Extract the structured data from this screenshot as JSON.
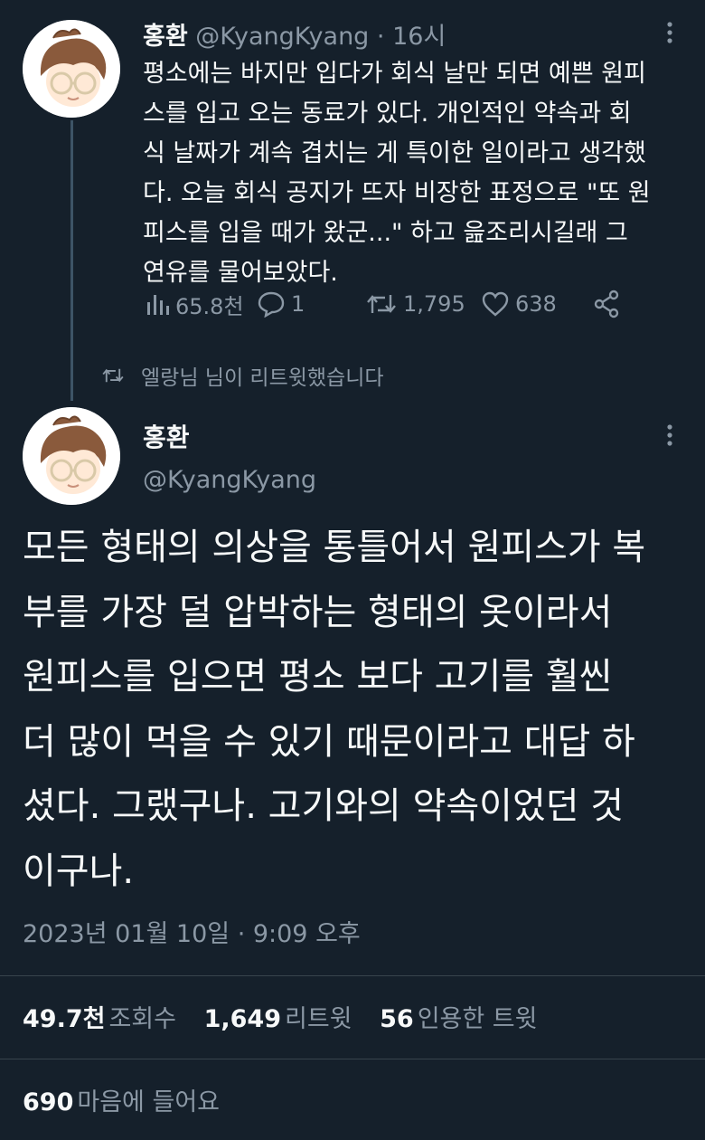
{
  "tweet1": {
    "display_name": "홍환",
    "handle": "@KyangKyang",
    "separator": "·",
    "time_ago": "16시",
    "text": "평소에는 바지만 입다가 회식 날만 되면 예쁜 원피\n스를 입고 오는 동료가 있다.  개인적인 약속과 회\n식 날짜가 계속 겹치는 게 특이한 일이라고 생각했\n다. 오늘 회식 공지가 뜨자 비장한 표정으로 \"또 원\n피스를 입을 때가 왔군...\" 하고 읊조리시길래 그\n연유를 물어보았다.",
    "actions": {
      "views": "65.8천",
      "replies": "1",
      "retweets": "1,795",
      "likes": "638"
    },
    "icons": [
      "analytics-icon",
      "reply-icon",
      "retweet-icon",
      "like-icon",
      "share-icon",
      "more-icon"
    ]
  },
  "retweet_note": "엘랑님 님이 리트윗했습니다",
  "tweet2": {
    "display_name": "홍환",
    "handle": "@KyangKyang",
    "text": "모든 형태의 의상을 통틀어서 원피스가 복\n부를 가장 덜 압박하는 형태의 옷이라서\n원피스를 입으면 평소 보다 고기를 훨씬\n더 많이 먹을 수 있기 때문이라고 대답 하\n셨다. 그랬구나. 고기와의 약속이었던 것\n이구나.",
    "timestamp": "2023년 01월 10일 · 9:09 오후",
    "stats": {
      "views_count": "49.7천",
      "views_label": "조회수",
      "retweets_count": "1,649",
      "retweets_label": "리트윗",
      "quotes_count": "56",
      "quotes_label": "인용한 트윗",
      "likes_count": "690",
      "likes_label": "마음에 들어요"
    }
  },
  "colors": {
    "background": "#15202b",
    "text": "#f7f9f9",
    "secondary": "#8b98a5",
    "divider": "#38444d",
    "thread_line": "#3d5466"
  }
}
